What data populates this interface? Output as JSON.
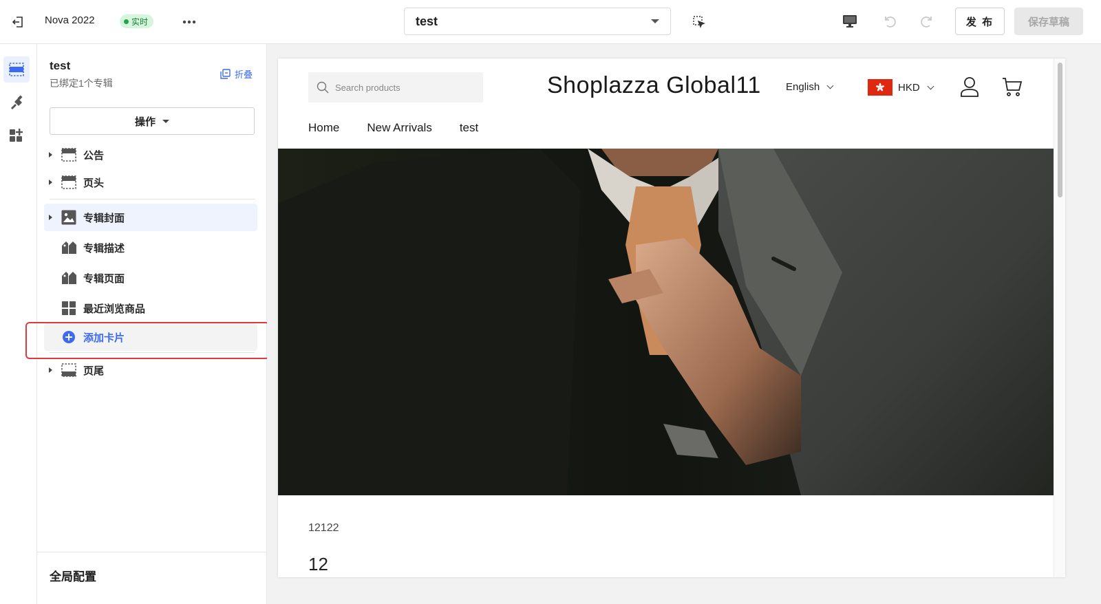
{
  "topbar": {
    "theme_name": "Nova 2022",
    "live_label": "实时",
    "page_select": "test",
    "publish_label": "发 布",
    "save_draft_label": "保存草稿"
  },
  "rail": {
    "items": [
      {
        "icon": "sections-icon",
        "active": true
      },
      {
        "icon": "theme-settings-icon",
        "active": false
      },
      {
        "icon": "apps-icon",
        "active": false
      }
    ]
  },
  "sidebar": {
    "title": "test",
    "subtitle": "已绑定1个专辑",
    "collapse_label": "折叠",
    "ops_label": "操作",
    "items": [
      {
        "label": "公告",
        "icon": "header-section-icon"
      },
      {
        "label": "页头",
        "icon": "header-section-icon"
      },
      {
        "label": "专辑封面",
        "icon": "image-icon",
        "selected": true
      },
      {
        "label": "专辑描述",
        "icon": "tag-icon"
      },
      {
        "label": "专辑页面",
        "icon": "tag-icon"
      },
      {
        "label": "最近浏览商品",
        "icon": "grid-icon"
      },
      {
        "label": "添加卡片",
        "icon": "add-circle-icon"
      },
      {
        "label": "页尾",
        "icon": "footer-section-icon"
      }
    ],
    "footer_label": "全局配置"
  },
  "preview": {
    "search_placeholder": "Search products",
    "shop_title": "Shoplazza Global11",
    "language": "English",
    "currency": "HKD",
    "nav": [
      "Home",
      "New Arrivals",
      "test"
    ],
    "section_text_1": "12122",
    "section_text_2": "12"
  },
  "colors": {
    "accent": "#3d6af2",
    "live_badge_bg": "#d6f5dd",
    "live_badge_text": "#1a7f37",
    "highlight_border": "#e0383e",
    "hk_flag": "#de2910"
  }
}
